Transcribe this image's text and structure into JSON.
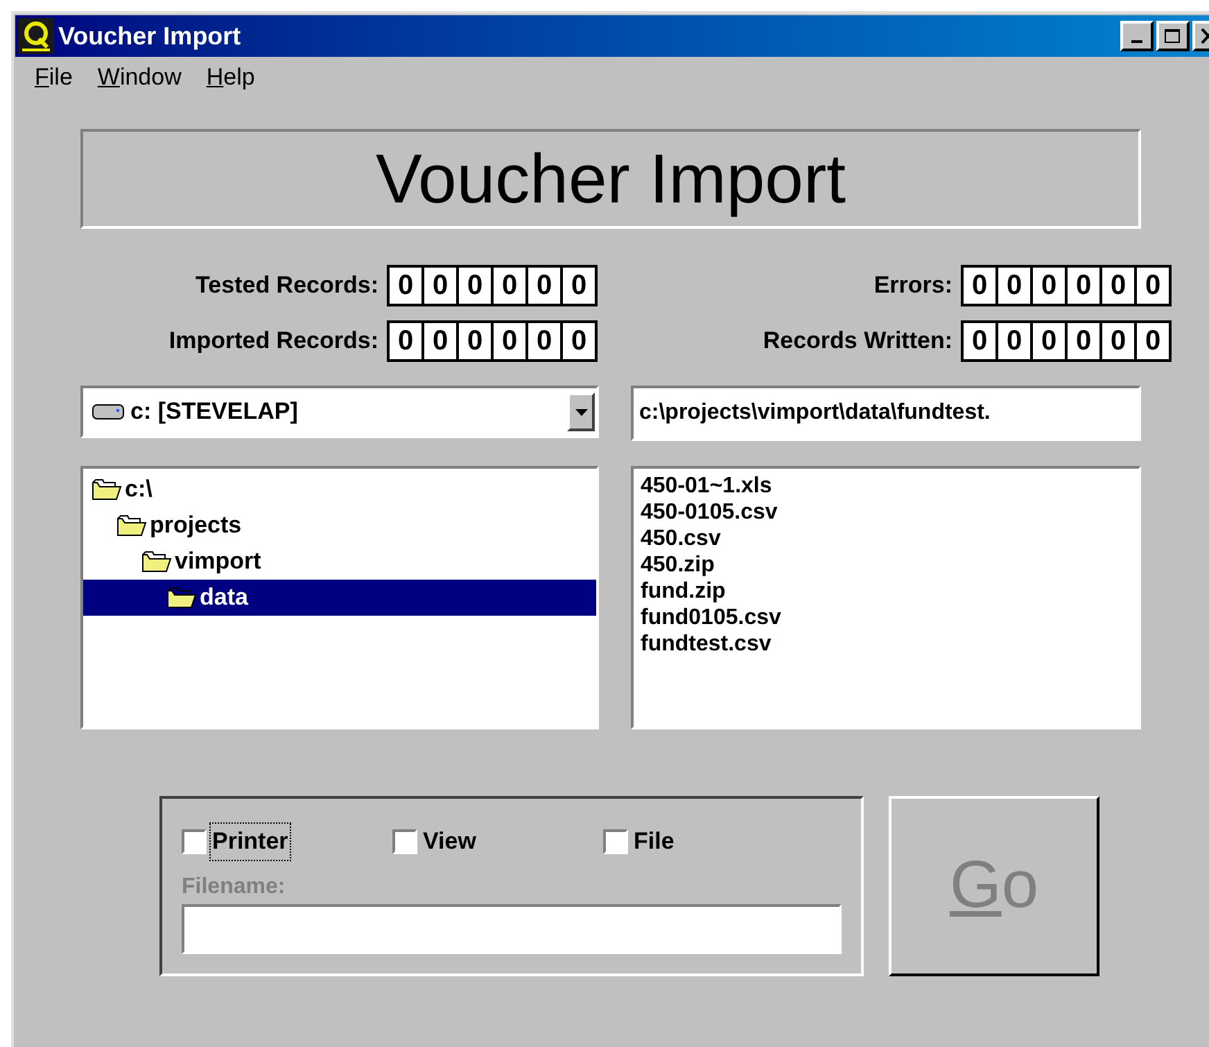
{
  "window": {
    "title": "Voucher Import"
  },
  "menu": [
    {
      "label": "File"
    },
    {
      "label": "Window"
    },
    {
      "label": "Help"
    }
  ],
  "banner": "Voucher Import",
  "counters": [
    {
      "label": "Tested Records:",
      "digits": [
        "0",
        "0",
        "0",
        "0",
        "0",
        "0"
      ]
    },
    {
      "label": "Errors:",
      "digits": [
        "0",
        "0",
        "0",
        "0",
        "0",
        "0"
      ]
    },
    {
      "label": "Imported Records:",
      "digits": [
        "0",
        "0",
        "0",
        "0",
        "0",
        "0"
      ]
    },
    {
      "label": "Records Written:",
      "digits": [
        "0",
        "0",
        "0",
        "0",
        "0",
        "0"
      ]
    }
  ],
  "drive_combo": {
    "value": "c: [STEVELAP]"
  },
  "path_field": {
    "value": "c:\\projects\\vimport\\data\\fundtest."
  },
  "folder_tree": [
    {
      "label": "c:\\",
      "selected": false,
      "children": [
        {
          "label": "projects",
          "selected": false,
          "children": [
            {
              "label": "vimport",
              "selected": false,
              "children": [
                {
                  "label": "data",
                  "selected": true
                }
              ]
            }
          ]
        }
      ]
    }
  ],
  "file_list": [
    {
      "label": "450-01~1.xls"
    },
    {
      "label": "450-0105.csv"
    },
    {
      "label": "450.csv"
    },
    {
      "label": "450.zip"
    },
    {
      "label": "fund.zip"
    },
    {
      "label": "fund0105.csv"
    },
    {
      "label": "fundtest.csv"
    }
  ],
  "output": {
    "options": [
      {
        "label": "Printer",
        "checked": false,
        "focused": true
      },
      {
        "label": "View",
        "checked": false,
        "focused": false
      },
      {
        "label": "File",
        "checked": false,
        "focused": false
      }
    ],
    "filename": {
      "label": "Filename:",
      "disabled": true
    }
  },
  "go_button": {
    "label": "Go",
    "disabled": true
  }
}
